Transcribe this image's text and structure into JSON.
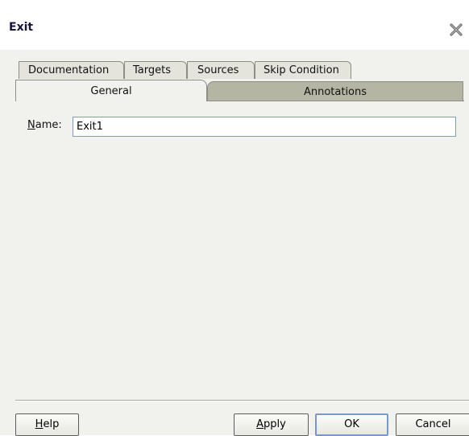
{
  "dialog": {
    "title": "Exit",
    "close_icon": "close-x-icon"
  },
  "tabs": {
    "row1": [
      {
        "label": "Documentation"
      },
      {
        "label": "Targets"
      },
      {
        "label": "Sources"
      },
      {
        "label": "Skip Condition"
      }
    ],
    "row2": [
      {
        "label": "General",
        "selected": true
      },
      {
        "label": "Annotations",
        "selected": false
      }
    ]
  },
  "general": {
    "name_label_mnemonic": "N",
    "name_label_rest": "ame:",
    "name_value": "Exit1"
  },
  "buttons": {
    "help_mnemonic": "H",
    "help_rest": "elp",
    "apply_mnemonic": "A",
    "apply_rest": "pply",
    "ok": "OK",
    "cancel": "Cancel"
  }
}
